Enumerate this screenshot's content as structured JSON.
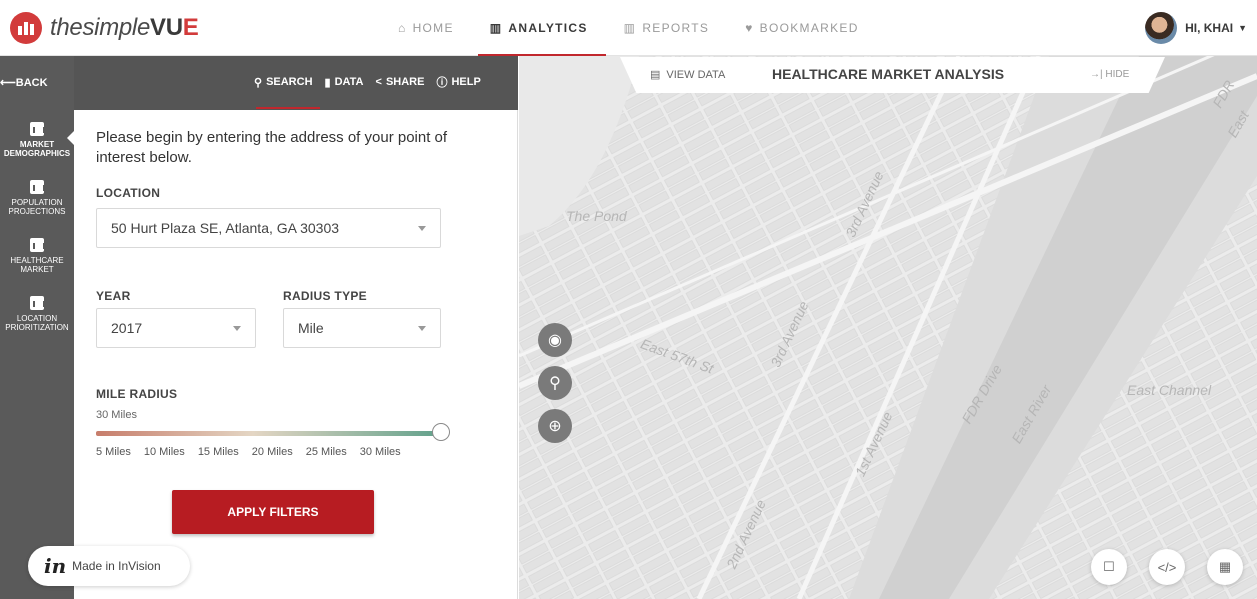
{
  "app": {
    "brand_prefix": "thesimple",
    "brand_main": "VU",
    "brand_accent": "E",
    "accent_color": "#c1272d"
  },
  "nav": {
    "items": [
      {
        "label": "HOME",
        "icon": "home-icon"
      },
      {
        "label": "ANALYTICS",
        "icon": "chart-icon",
        "active": true
      },
      {
        "label": "REPORTS",
        "icon": "report-icon"
      },
      {
        "label": "BOOKMARKED",
        "icon": "heart-icon"
      }
    ],
    "user_greeting": "HI, KHAI"
  },
  "toolbar": {
    "back": "BACK",
    "search": "SEARCH",
    "data": "DATA",
    "share": "SHARE",
    "help": "HELP"
  },
  "rail": {
    "items": [
      {
        "line1": "MARKET",
        "line2": "DEMOGRAPHICS",
        "active": true
      },
      {
        "line1": "POPULATION",
        "line2": "PROJECTIONS"
      },
      {
        "line1": "HEALTHCARE",
        "line2": "MARKET"
      },
      {
        "line1": "LOCATION",
        "line2": "PRIORITIZATION"
      }
    ]
  },
  "form": {
    "intro": "Please begin by entering the address of your point of interest below.",
    "location_label": "LOCATION",
    "location_value": "50 Hurt Plaza SE, Atlanta, GA 30303",
    "year_label": "YEAR",
    "year_value": "2017",
    "radius_type_label": "RADIUS TYPE",
    "radius_type_value": "Mile",
    "mile_radius_label": "MILE RADIUS",
    "mile_radius_value": "30 Miles",
    "slider_fraction": 1.0,
    "ticks": [
      "5 Miles",
      "10 Miles",
      "15 Miles",
      "20 Miles",
      "25 Miles",
      "30 Miles"
    ],
    "apply": "APPLY FILTERS"
  },
  "invision": {
    "mark": "in",
    "text": "Made in InVision"
  },
  "map": {
    "view_data": "VIEW DATA",
    "title": "HEALTHCARE MARKET ANALYSIS",
    "hide": "HIDE",
    "labels": {
      "pond": "The Pond",
      "east_57": "East 57th St",
      "third_ave_a": "3rd Avenue",
      "third_ave_b": "3rd Avenue",
      "first_ave": "1st Avenue",
      "second_ave": "2nd Avenue",
      "fdr": "FDR Drive",
      "east_river": "East River",
      "east_channel": "East Channel",
      "fdr_top": "FDR",
      "east_top": "East"
    }
  }
}
